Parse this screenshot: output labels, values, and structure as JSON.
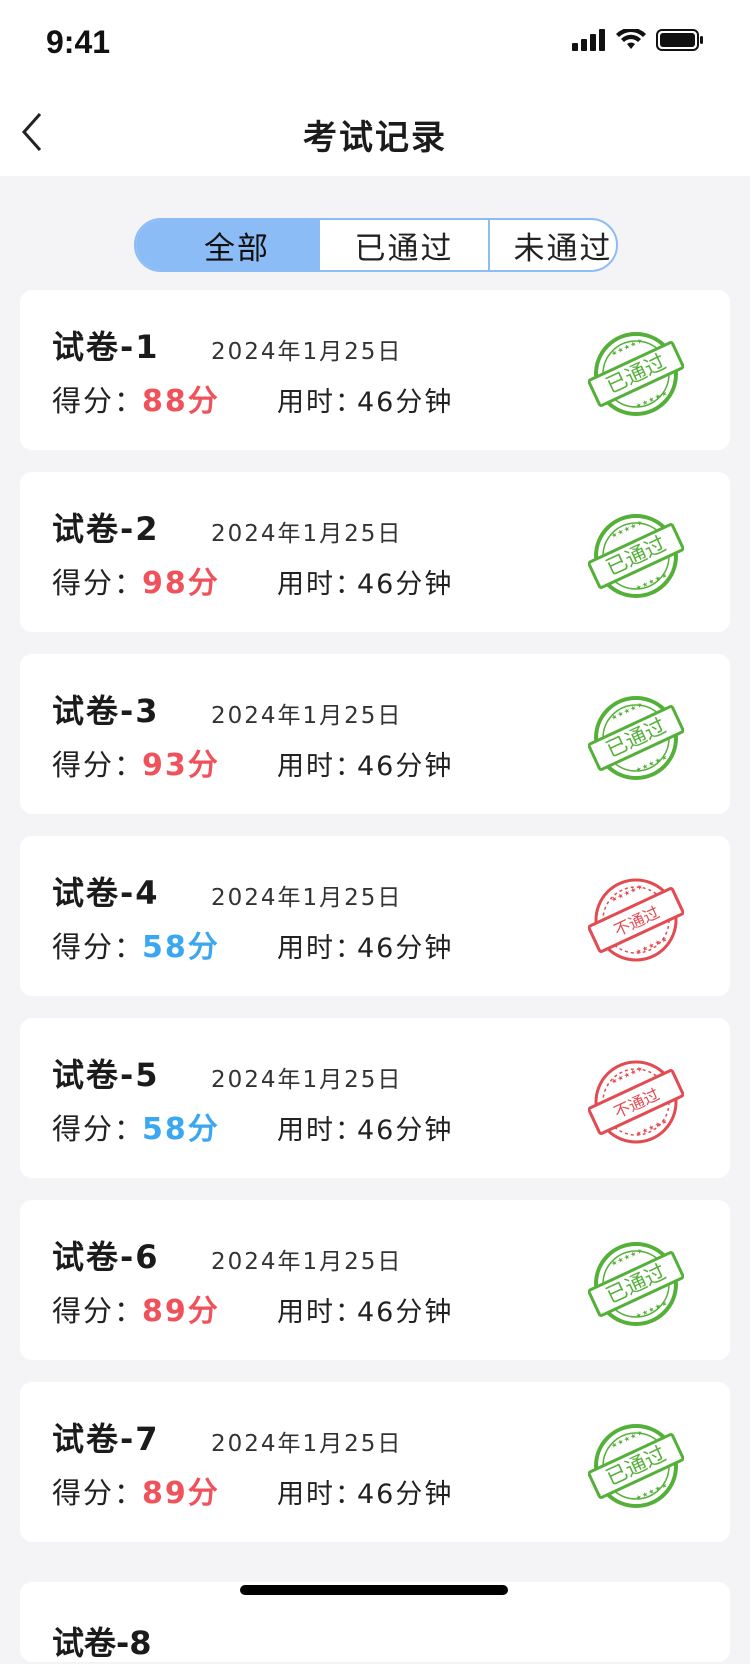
{
  "status": {
    "time": "9:41"
  },
  "nav": {
    "title": "考试记录"
  },
  "tabs": [
    {
      "label": "全部",
      "active": true
    },
    {
      "label": "已通过",
      "active": false
    },
    {
      "label": "未通过",
      "active": false
    }
  ],
  "colors": {
    "pass_green": "#55b03a",
    "fail_red": "#e24b52",
    "score_red": "#f0525c",
    "score_blue": "#3aa7f0",
    "tab_blue": "#8cbcf5"
  },
  "records": [
    {
      "title": "试卷-1",
      "date": "2024年1月25日",
      "score_label": "得分：",
      "score": "88分",
      "time_label": "用时：",
      "time": "46分钟",
      "stamp": "已通过"
    },
    {
      "title": "试卷-2",
      "date": "2024年1月25日",
      "score_label": "得分：",
      "score": "98分",
      "time_label": "用时：",
      "time": "46分钟",
      "stamp": "已通过"
    },
    {
      "title": "试卷-3",
      "date": "2024年1月25日",
      "score_label": "得分：",
      "score": "93分",
      "time_label": "用时：",
      "time": "46分钟",
      "stamp": "已通过"
    },
    {
      "title": "试卷-4",
      "date": "2024年1月25日",
      "score_label": "得分：",
      "score": "58分",
      "time_label": "用时：",
      "time": "46分钟",
      "stamp": "不通过"
    },
    {
      "title": "试卷-5",
      "date": "2024年1月25日",
      "score_label": "得分：",
      "score": "58分",
      "time_label": "用时：",
      "time": "46分钟",
      "stamp": "不通过"
    },
    {
      "title": "试卷-6",
      "date": "2024年1月25日",
      "score_label": "得分：",
      "score": "89分",
      "time_label": "用时：",
      "time": "46分钟",
      "stamp": "已通过"
    },
    {
      "title": "试卷-7",
      "date": "2024年1月25日",
      "score_label": "得分：",
      "score": "89分",
      "time_label": "用时：",
      "time": "46分钟",
      "stamp": "已通过"
    }
  ],
  "partial_record": {
    "title": "试卷-8"
  }
}
